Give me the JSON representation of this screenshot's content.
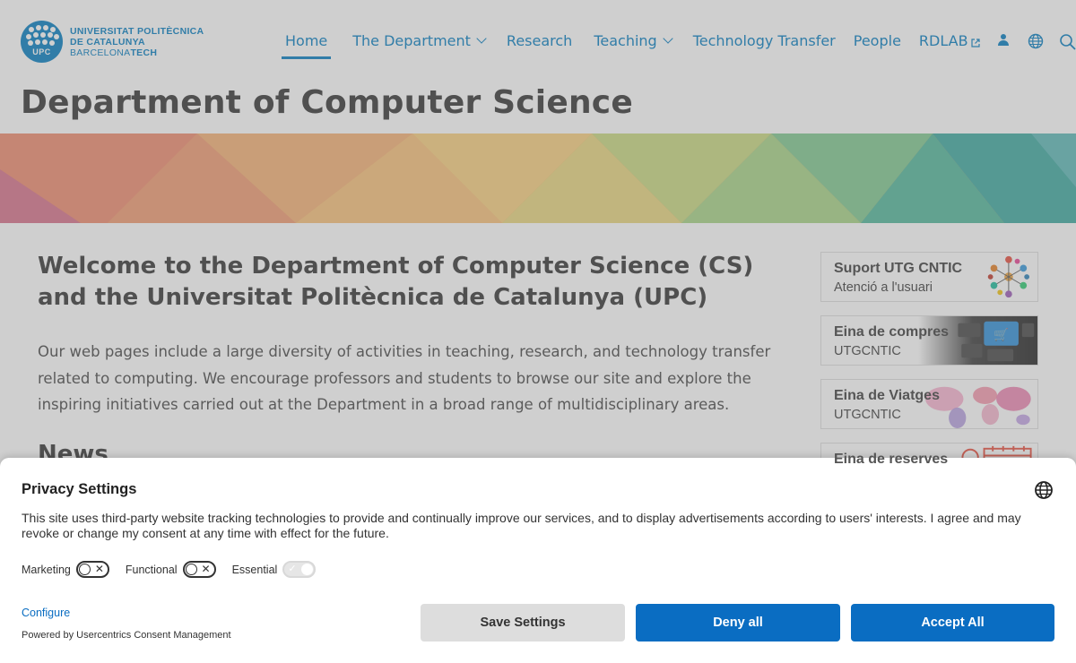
{
  "header": {
    "logo": {
      "mark_text": "UPC",
      "line1": "UNIVERSITAT POLITÈCNICA",
      "line2": "DE CATALUNYA",
      "line3_a": "BARCELONA",
      "line3_b": "TECH",
      "color": "#007bc0"
    },
    "nav": [
      {
        "label": "Home",
        "active": true
      },
      {
        "label": "The Department",
        "has_dropdown": true
      },
      {
        "label": "Research"
      },
      {
        "label": "Teaching",
        "has_dropdown": true
      },
      {
        "label": "Technology Transfer"
      },
      {
        "label": "People"
      },
      {
        "label": "RDLAB",
        "external": true
      }
    ],
    "icons": [
      "user-icon",
      "globe-icon",
      "search-icon"
    ]
  },
  "page_title": "Department of Computer Science",
  "main": {
    "welcome": "Welcome to the Department of Computer Science (CS) and the Universitat Politècnica de Catalunya (UPC)",
    "intro": "Our web pages include a large diversity of activities in teaching, research, and technology transfer related to computing. We encourage professors and students to browse our site and explore the inspiring initiatives carried out at the Department in a broad range of multidisciplinary areas.",
    "news_heading": "News"
  },
  "sidebar": {
    "cards": [
      {
        "title": "Suport UTG CNTIC",
        "subtitle": "Atenció a l'usuari"
      },
      {
        "title": "Eina de compres",
        "subtitle": "UTGCNTIC"
      },
      {
        "title": "Eina de Viatges",
        "subtitle": "UTGCNTIC"
      },
      {
        "title": "Eina de reserves",
        "subtitle": ""
      }
    ]
  },
  "privacy": {
    "title": "Privacy Settings",
    "text": "This site uses third-party website tracking technologies to provide and continually improve our services, and to display advertisements according to users' interests. I agree and may revoke or change my consent at any time with effect for the future.",
    "toggles": [
      {
        "label": "Marketing",
        "state": "off"
      },
      {
        "label": "Functional",
        "state": "off"
      },
      {
        "label": "Essential",
        "state": "on-disabled"
      }
    ],
    "configure_link": "Configure",
    "powered_by": "Powered by Usercentrics Consent Management",
    "buttons": {
      "save": "Save Settings",
      "deny": "Deny all",
      "accept": "Accept All"
    },
    "accent_color": "#0a6dc2"
  }
}
